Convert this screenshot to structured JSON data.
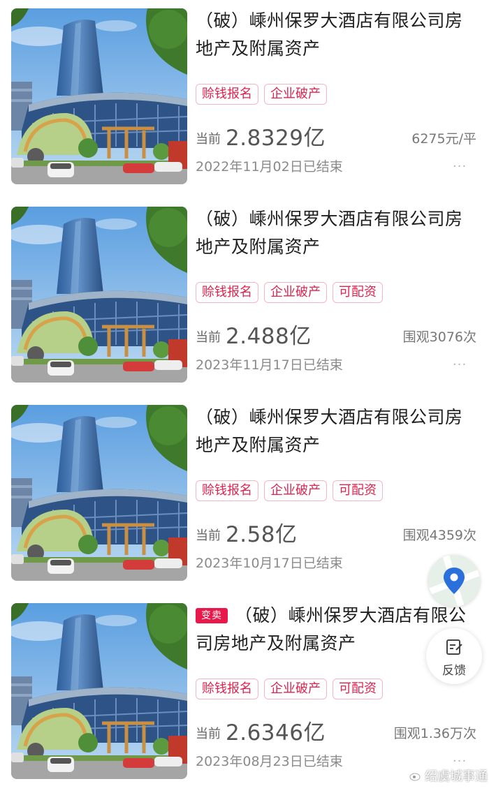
{
  "listings": [
    {
      "title": "（破）嵊州保罗大酒店有限公司房地产及附属资产",
      "badge": "",
      "tags": [
        "赊钱报名",
        "企业破产"
      ],
      "price_prefix": "当前",
      "price": "2.8329亿",
      "stat": "6275元/平",
      "date": "2022年11月02日已结束",
      "more": "···"
    },
    {
      "title": "（破）嵊州保罗大酒店有限公司房地产及附属资产",
      "badge": "",
      "tags": [
        "赊钱报名",
        "企业破产",
        "可配资"
      ],
      "price_prefix": "当前",
      "price": "2.488亿",
      "stat": "围观3076次",
      "date": "2023年11月17日已结束",
      "more": "···"
    },
    {
      "title": "（破）嵊州保罗大酒店有限公司房地产及附属资产",
      "badge": "",
      "tags": [
        "赊钱报名",
        "企业破产",
        "可配资"
      ],
      "price_prefix": "当前",
      "price": "2.58亿",
      "stat": "围观4359次",
      "date": "2023年10月17日已结束",
      "more": "···"
    },
    {
      "title": "（破）嵊州保罗大酒店有限公司房地产及附属资产",
      "badge": "变卖",
      "tags": [
        "赊钱报名",
        "企业破产",
        "可配资"
      ],
      "price_prefix": "当前",
      "price": "2.6346亿",
      "stat": "围观1.36万次",
      "date": "2023年08月23日已结束",
      "more": "···"
    }
  ],
  "floating": {
    "feedback_label": "反馈",
    "map_icon": "map-pin-icon",
    "feedback_icon": "edit-note-icon"
  },
  "watermark": "绍虞城事通",
  "colors": {
    "badge": "#e8194a",
    "tag_text": "#e0234e",
    "tag_border": "#f3b6c3"
  }
}
